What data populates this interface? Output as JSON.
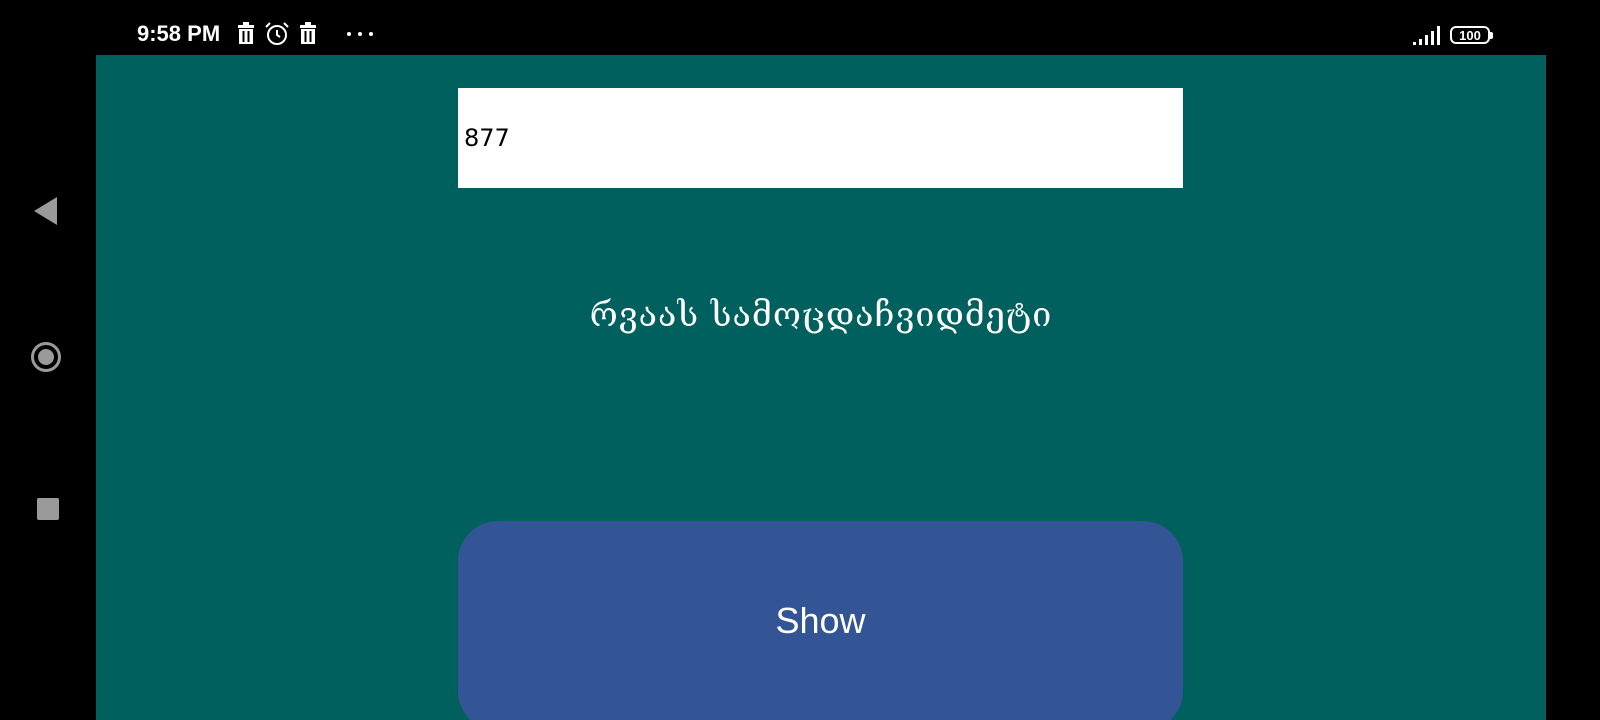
{
  "status_bar": {
    "time": "9:58 PM",
    "left_icons": [
      "trash-icon",
      "alarm-clock-icon",
      "trash-icon",
      "more-dots-icon"
    ],
    "battery_level": "100",
    "signal_icon": "signal-bars-icon"
  },
  "navigation": {
    "back_icon": "back-triangle-icon",
    "home_icon": "home-circle-icon",
    "recents_icon": "recents-square-icon"
  },
  "app": {
    "input_value": "877",
    "result_text": "რვაას სამოცდაჩვიდმეტი",
    "show_button_label": "Show",
    "colors": {
      "background": "#00605d",
      "button": "#335596",
      "input_background": "#ffffff",
      "text": "#ffffff"
    }
  }
}
